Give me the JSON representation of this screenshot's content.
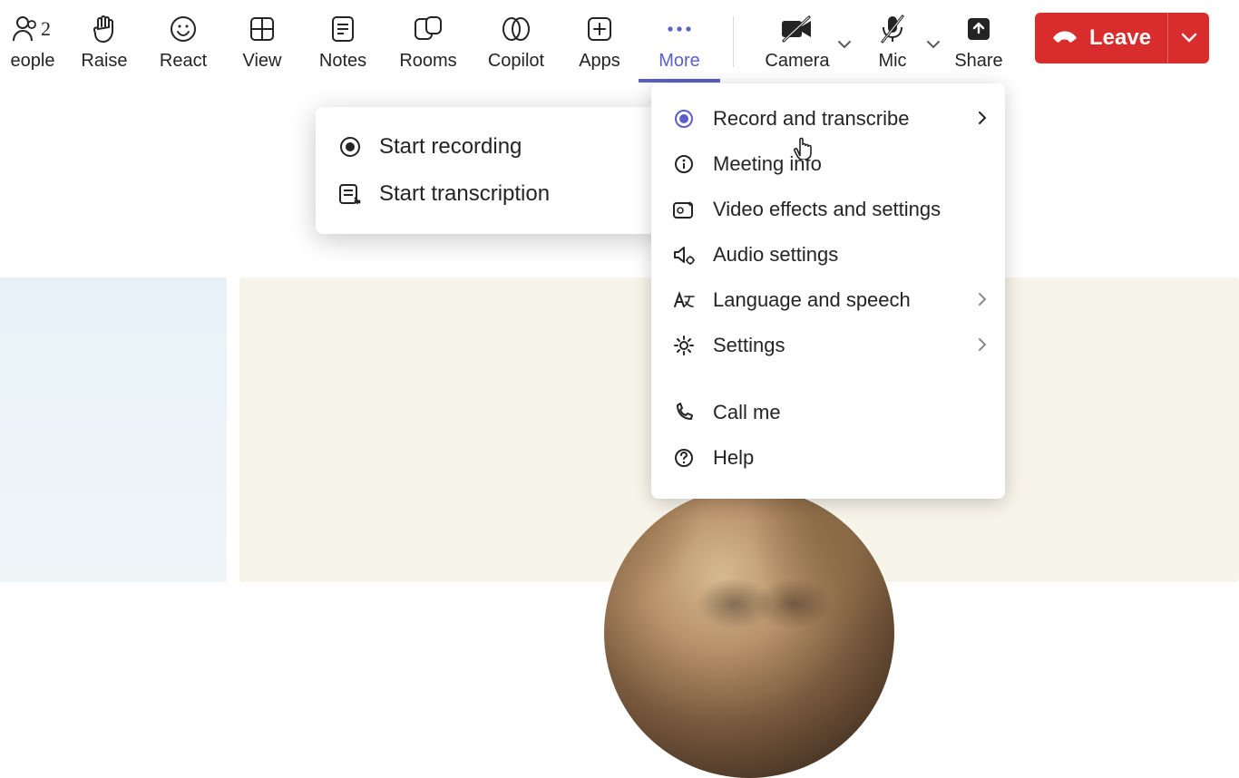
{
  "toolbar": {
    "people": {
      "label": "eople",
      "count": "2"
    },
    "raise": {
      "label": "Raise"
    },
    "react": {
      "label": "React"
    },
    "view": {
      "label": "View"
    },
    "notes": {
      "label": "Notes"
    },
    "rooms": {
      "label": "Rooms"
    },
    "copilot": {
      "label": "Copilot"
    },
    "apps": {
      "label": "Apps"
    },
    "more": {
      "label": "More"
    },
    "camera": {
      "label": "Camera"
    },
    "mic": {
      "label": "Mic"
    },
    "share": {
      "label": "Share"
    },
    "leave": {
      "label": "Leave"
    }
  },
  "more_menu": {
    "record_transcribe": "Record and transcribe",
    "meeting_info": "Meeting info",
    "video_effects": "Video effects and settings",
    "audio_settings": "Audio settings",
    "language_speech": "Language and speech",
    "settings": "Settings",
    "call_me": "Call me",
    "help": "Help"
  },
  "submenu": {
    "start_recording": "Start recording",
    "start_transcription": "Start transcription"
  },
  "colors": {
    "accent": "#5b5fc7",
    "danger": "#d92c2c"
  }
}
